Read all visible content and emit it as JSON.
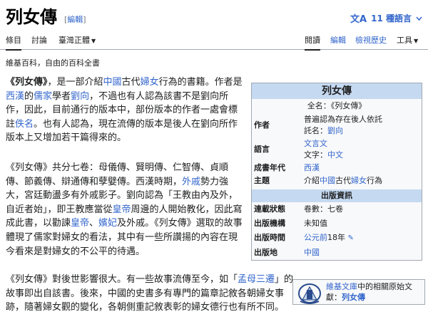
{
  "header": {
    "title": "列女傳",
    "edit_bracket_open": "[",
    "edit_label": "編輯",
    "edit_bracket_close": "]",
    "languages": "11 種語言",
    "lang_icon": "文A"
  },
  "tabs": {
    "left": [
      "條目",
      "討論",
      "臺灣正體"
    ],
    "right": [
      "閱讀",
      "編輯",
      "檢視歷史",
      "工具"
    ]
  },
  "tagline": "維基百科，自由的百科全書",
  "paragraph1": {
    "s1": "《列女傳》",
    "s2": "，是一部介紹",
    "s3": "中國",
    "s4": "古代",
    "s5": "婦女",
    "s6": "行為的書籍。作者是",
    "s7": "西漢",
    "s8": "的",
    "s9": "儒家",
    "s10": "學者",
    "s11": "劉向",
    "s12": "，不過也有人認為該書不是劉向所作，因此，目前通行的版本中，部份版本的作者一處會標註",
    "s13": "佚名",
    "s14": "。也有人認為，現在流傳的版本是後人在劉向所作版本上又增加若干篇得來的。"
  },
  "paragraph2": {
    "s1": "《列女傳》共分七卷：母儀傳、賢明傳、仁智傳、貞順傳、節義傳、辯通傳和孽嬖傳。西漢時期，",
    "s2": "外戚",
    "s3": "勢力強大，宮廷動盪多有外戚影子。劉向認為「王教由內及外，自近者始」，即王教應當從",
    "s4": "皇帝",
    "s5": "周邊的人開始教化，因此寫成此書，以勸諫",
    "s6": "皇帝",
    "s7": "、",
    "s8": "嬪妃",
    "s9": "及外戚。《列女傳》選取的故事體現了儒家對婦女的看法，其中有一些所讚揚的內容在現今看來是對婦女的不公平的待遇。"
  },
  "paragraph3": {
    "s1": "《列女傳》對後世影響很大。有一些故事流傳至今，如「",
    "s2": "孟母三遷",
    "s3": "」的故事即出自該書。後來，中國的史書多有專門的篇章記敘各朝婦女事跡，隨著婦女觀的變化，各朝側重記敘表彰的婦女德行也有所不同。"
  },
  "infobox": {
    "title": "列女傳",
    "fullname": "全名：《列女傳》",
    "author_label": "作者",
    "author_line1": "普遍認為存在後人依託",
    "author_line2_prefix": "託名：",
    "author_line2_link": "劉向",
    "language_label": "語言",
    "language_link": "文言文",
    "script_prefix": "文字：",
    "script_link": "中文",
    "era_label": "成書年代",
    "era_link": "西漢",
    "topic_label": "主題",
    "topic_s1": "介紹",
    "topic_s2": "中國",
    "topic_s3": "古代",
    "topic_s4": "婦女",
    "topic_s5": "行為",
    "pub_header": "出版資訊",
    "status_label": "連載狀態",
    "status_value": "卷數：七卷",
    "publisher_label": "出版機構",
    "publisher_value": "未知值",
    "date_label": "出版時間",
    "date_link": "公元前",
    "date_suffix": "18年",
    "place_label": "出版地",
    "place_link": "中國"
  },
  "wikisource": {
    "text1": "維基文庫",
    "text2": "中的相關原始文獻：",
    "link": "列女傳"
  }
}
